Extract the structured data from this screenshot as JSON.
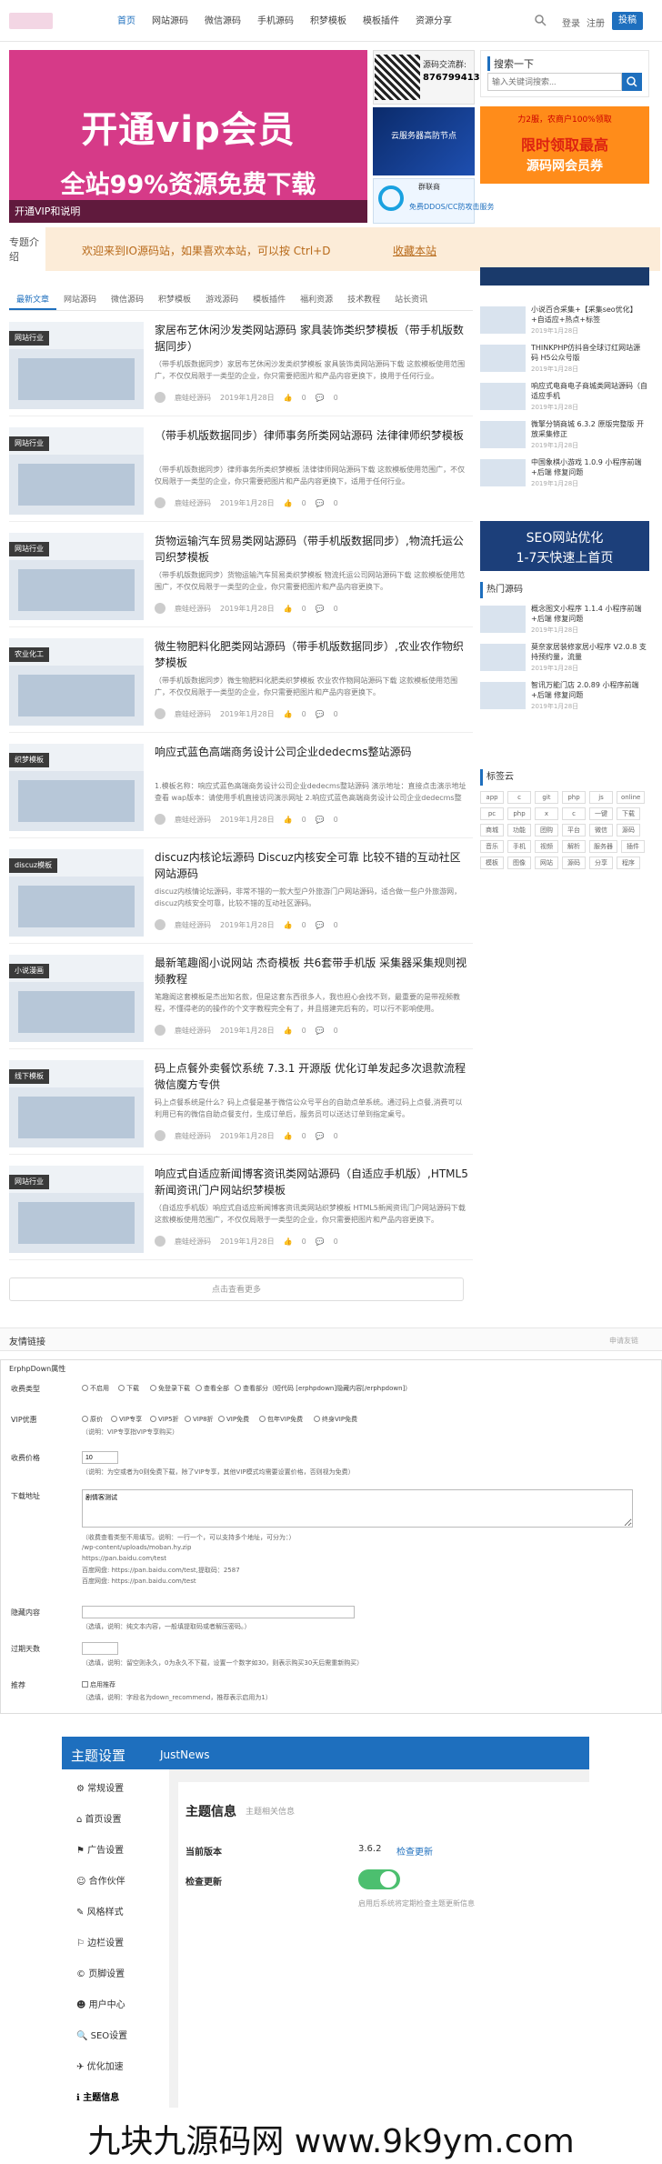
{
  "nav": {
    "items": [
      "首页",
      "网站源码",
      "微信源码",
      "手机源码",
      "积梦模板",
      "模板插件",
      "资源分享"
    ],
    "login": "登录",
    "register": "注册",
    "post": "投稿"
  },
  "hero": {
    "title": "开通vip会员",
    "subtitle": "全站99%资源免费下载",
    "caption": "开通VIP和说明"
  },
  "qr": {
    "line1": "源码交流群:",
    "line2": "876799413"
  },
  "ads": {
    "cloud": "云服务器高防节点",
    "cdn_title": "群联商",
    "cdn_sub": "免费DDOS/CC防攻击服务",
    "vip_top": "力2服，农商户100%领取",
    "vip_mid": "限时领取最高",
    "vip_bottom": "源码网会员券",
    "seo_1": "SEO网站优化",
    "seo_2": "1-7天快速上首页"
  },
  "search": {
    "title": "搜索一下",
    "placeholder": "输入关键词搜索..."
  },
  "notice": {
    "label": "专题介绍",
    "text": "欢迎来到IO源码站，如果喜欢本站，可以按 Ctrl+D",
    "link": "收藏本站"
  },
  "tabs": [
    "最新文章",
    "网站源码",
    "微信源码",
    "积梦模板",
    "游戏源码",
    "模板插件",
    "福利资源",
    "技术教程",
    "站长资讯"
  ],
  "articles": [
    {
      "badge": "网站行业",
      "title": "家居布艺休闲沙发类网站源码 家具装饰类织梦模板（带手机版数据同步）",
      "desc": "（带手机版数据同步）家居布艺休闲沙发类织梦模板 家具装饰类网站源码下载 这款模板使用范围广，不仅仅局限于一类型的企业，你只需要把图片和产品内容更换下，换用于任何行业。",
      "author": "鹿蛙经源码",
      "date": "2019年1月28日",
      "likes": "0",
      "comments": "0"
    },
    {
      "badge": "网站行业",
      "title": "（带手机版数据同步）律师事务所类网站源码 法律律师织梦模板",
      "desc": "（带手机版数据同步）律师事务所类织梦模板 法律律师网站源码下载 这款模板使用范围广，不仅仅局限于一类型的企业，你只需要把图片和产品内容更换下，适用于任何行业。",
      "author": "鹿蛙经源码",
      "date": "2019年1月28日",
      "likes": "0",
      "comments": "0"
    },
    {
      "badge": "网站行业",
      "title": "货物运输汽车贸易类网站源码（带手机版数据同步）,物流托运公司织梦模板",
      "desc": "（带手机版数据同步）货物运输汽车贸易类织梦模板 物流托运公司网站源码下载 这款模板使用范围广，不仅仅局限于一类型的企业，你只需要把图片和产品内容更换下。",
      "author": "鹿蛙经源码",
      "date": "2019年1月28日",
      "likes": "0",
      "comments": "0"
    },
    {
      "badge": "农业化工",
      "title": "微生物肥料化肥类网站源码（带手机版数据同步）,农业农作物织梦模板",
      "desc": "（带手机版数据同步）微生物肥料化肥类织梦模板 农业农作物网站源码下载 这款模板使用范围广，不仅仅局限于一类型的企业，你只需要把图片和产品内容更换下。",
      "author": "鹿蛙经源码",
      "date": "2019年1月28日",
      "likes": "0",
      "comments": "0"
    },
    {
      "badge": "织梦模板",
      "title": "响应式蓝色高端商务设计公司企业dedecms整站源码",
      "desc": "1.模板名称：响应式蓝色高端商务设计公司企业dedecms整站源码 演示地址：直接点击演示地址查看 wap版本：请使用手机直接访问演示网址 2.响应式蓝色高端商务设计公司企业dedecms整站源码。",
      "author": "鹿蛙经源码",
      "date": "2019年1月28日",
      "likes": "0",
      "comments": "0"
    },
    {
      "badge": "discuz模板",
      "title": "discuz内核论坛源码 Discuz内核安全可靠 比较不错的互动社区网站源码",
      "desc": "discuz内核情论坛源码，非常不错的一款大型户外旅游门户网站源码，适合做一些户外旅游网，discuz内核安全可靠，比较不错的互动社区源码。",
      "author": "鹿蛙经源码",
      "date": "2019年1月28日",
      "likes": "0",
      "comments": "0"
    },
    {
      "badge": "小说漫画",
      "title": "最新笔趣阁小说网站 杰奇模板 共6套带手机版 采集器采集规则视频教程",
      "desc": "笔趣阁这套模板是杰出知名款，但是这套东西很多人，我也担心会找不到，最重要的是带视频教程，不懂得老的的操作的个文字教程完全有了，并且搭建完后有的，可以行不影响使用。",
      "author": "鹿蛙经源码",
      "date": "2019年1月28日",
      "likes": "0",
      "comments": "0"
    },
    {
      "badge": "线下模板",
      "title": "码上点餐外卖餐饮系统 7.3.1 开源版 优化订单发起多次退款流程 微信魔方专供",
      "desc": "码上点餐系统是什么？码上点餐是基于微信公众号平台的自助点单系统。通过码上点餐,消费可以利用已有的微信自助点餐支付，生成订单后，服务员可以送达订单到指定桌号。",
      "author": "鹿蛙经源码",
      "date": "2019年1月28日",
      "likes": "0",
      "comments": "0"
    },
    {
      "badge": "网站行业",
      "title": "响应式自适应新闻博客资讯类网站源码（自适应手机版）,HTML5新闻资讯门户网站织梦模板",
      "desc": "（自适应手机版）响应式自适应新闻博客资讯类网站织梦模板 HTML5新闻资讯门户网站源码下载 这款模板使用范围广，不仅仅局限于一类型的企业，你只需要把图片和产品内容更换下。",
      "author": "鹿蛙经源码",
      "date": "2019年1月28日",
      "likes": "0",
      "comments": "0"
    }
  ],
  "load_more": "点击查看更多",
  "sidebar": {
    "recent": [
      {
        "title": "小说百合采集+【采集seo优化】+自适应+热点+标签",
        "date": "2019年1月28日"
      },
      {
        "title": "THINKPHP仿抖音全球订红网站源码 H5公众号版",
        "date": "2019年1月28日"
      },
      {
        "title": "响应式电商电子商城类网站源码（自适应手机",
        "date": "2019年1月28日"
      },
      {
        "title": "微擎分销商城 6.3.2 原版完整版 开放采集修正",
        "date": "2019年1月28日"
      },
      {
        "title": "中国象棋小游戏 1.0.9 小程序前端+后端 修复问题",
        "date": "2019年1月28日"
      }
    ],
    "hot_title": "热门源码",
    "hot": [
      {
        "title": "概念图文小程序 1.1.4 小程序前端+后端 修复问题",
        "date": "2019年1月28日"
      },
      {
        "title": "莫奈家居装修家居小程序 V2.0.8 支持预约量，流量",
        "date": "2019年1月28日"
      },
      {
        "title": "智讯万能门店 2.0.89 小程序前端+后端 修复问题",
        "date": "2019年1月28日"
      }
    ],
    "tags_title": "标签云",
    "tags": [
      "app",
      "c",
      "git",
      "php",
      "js",
      "online",
      "pc",
      "php",
      "x",
      "c",
      "一键",
      "下载",
      "商城",
      "功能",
      "团购",
      "平台",
      "微信",
      "源码",
      "音乐",
      "手机",
      "视频",
      "解析",
      "服务器",
      "插件",
      "模板",
      "图像",
      "网站",
      "源码",
      "分享",
      "程序"
    ]
  },
  "friends": {
    "title": "友情链接",
    "apply": "申请友链"
  },
  "form": {
    "title": "ErphpDown属性",
    "fields": [
      {
        "label": "收费类型",
        "options": [
          "不启用",
          "下载",
          "免登录下载",
          "查看全部",
          "查看部分（短代码 [erphpdown]隐藏内容[/erphpdown]）"
        ]
      },
      {
        "label": "VIP优惠",
        "options": [
          "原价",
          "VIP专享",
          "VIP5折",
          "VIP8折",
          "VIP免费",
          "包年VIP免费",
          "终身VIP免费"
        ]
      },
      {
        "label": "收费价格",
        "value": "10"
      },
      {
        "label": "下载地址",
        "value": "剧情客测试"
      },
      {
        "label": "隐藏内容",
        "value": ""
      },
      {
        "label": "过期天数",
        "value": ""
      },
      {
        "label": "推荐",
        "checkbox": "启用推荐"
      }
    ],
    "notes": [
      "（说明：VIP专享指VIP专享购买）",
      "（说明：为空或者为0则免费下载，除了VIP专享，其他VIP模式均需要设置价格，否则视为免费）",
      "（收费查看类型不用填写。说明：一行一个，可以支持多个地址，可分为：）",
      "/wp-content/uploads/moban.hy.zip",
      "https://pan.baidu.com/test",
      "百度网盘: https://pan.baidu.com/test,提取码：2587",
      "百度网盘: https://pan.baidu.com/test",
      "（选填，说明：纯文本内容，一般填提取码或者解压密码。）",
      "（选填，说明：留空则永久，0为永久不下载，设置一个数字如30，则表示购买30天后需重新购买）",
      "（选填，说明：字段名为down_recommend，推荐表示启用为1）"
    ]
  },
  "theme": {
    "title": "主题设置",
    "name": "JustNews",
    "nav": [
      "常规设置",
      "首页设置",
      "广告设置",
      "合作伙伴",
      "风格样式",
      "边栏设置",
      "页脚设置",
      "用户中心",
      "SEO设置",
      "优化加速",
      "主题信息"
    ],
    "main_title": "主题信息",
    "main_sub": "主题相关信息",
    "version_label": "当前版本",
    "version": "3.6.2",
    "check": "检查更新",
    "update_label": "检查更新",
    "update_note": "启用后系统将定期检查主题更新信息"
  },
  "watermark": "九块九源码网 www.9k9ym.com",
  "colors": {
    "accent": "#1e6fbe",
    "hero": "#d63a88",
    "notice": "#fcecd8",
    "toggle": "#4cbf6f"
  }
}
